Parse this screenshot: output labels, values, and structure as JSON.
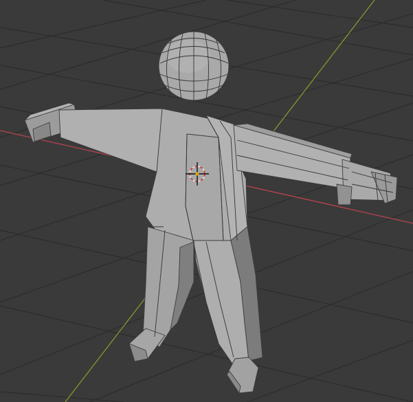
{
  "viewport": {
    "colors": {
      "background": "#3a3a3a",
      "grid_line": "#2c2c2c",
      "x_axis": "#b8434f",
      "y_axis": "#7f9a2b",
      "mesh_light": "#b2b2b2",
      "mesh_mid": "#a8a8a8",
      "mesh_dark": "#8a8a8a",
      "mesh_wire": "#3c3c3c"
    },
    "objects": [
      {
        "name": "head",
        "shape": "uv-sphere"
      },
      {
        "name": "body",
        "shape": "low-poly-humanoid"
      }
    ],
    "cursor_icon": "3d-cursor-icon"
  }
}
